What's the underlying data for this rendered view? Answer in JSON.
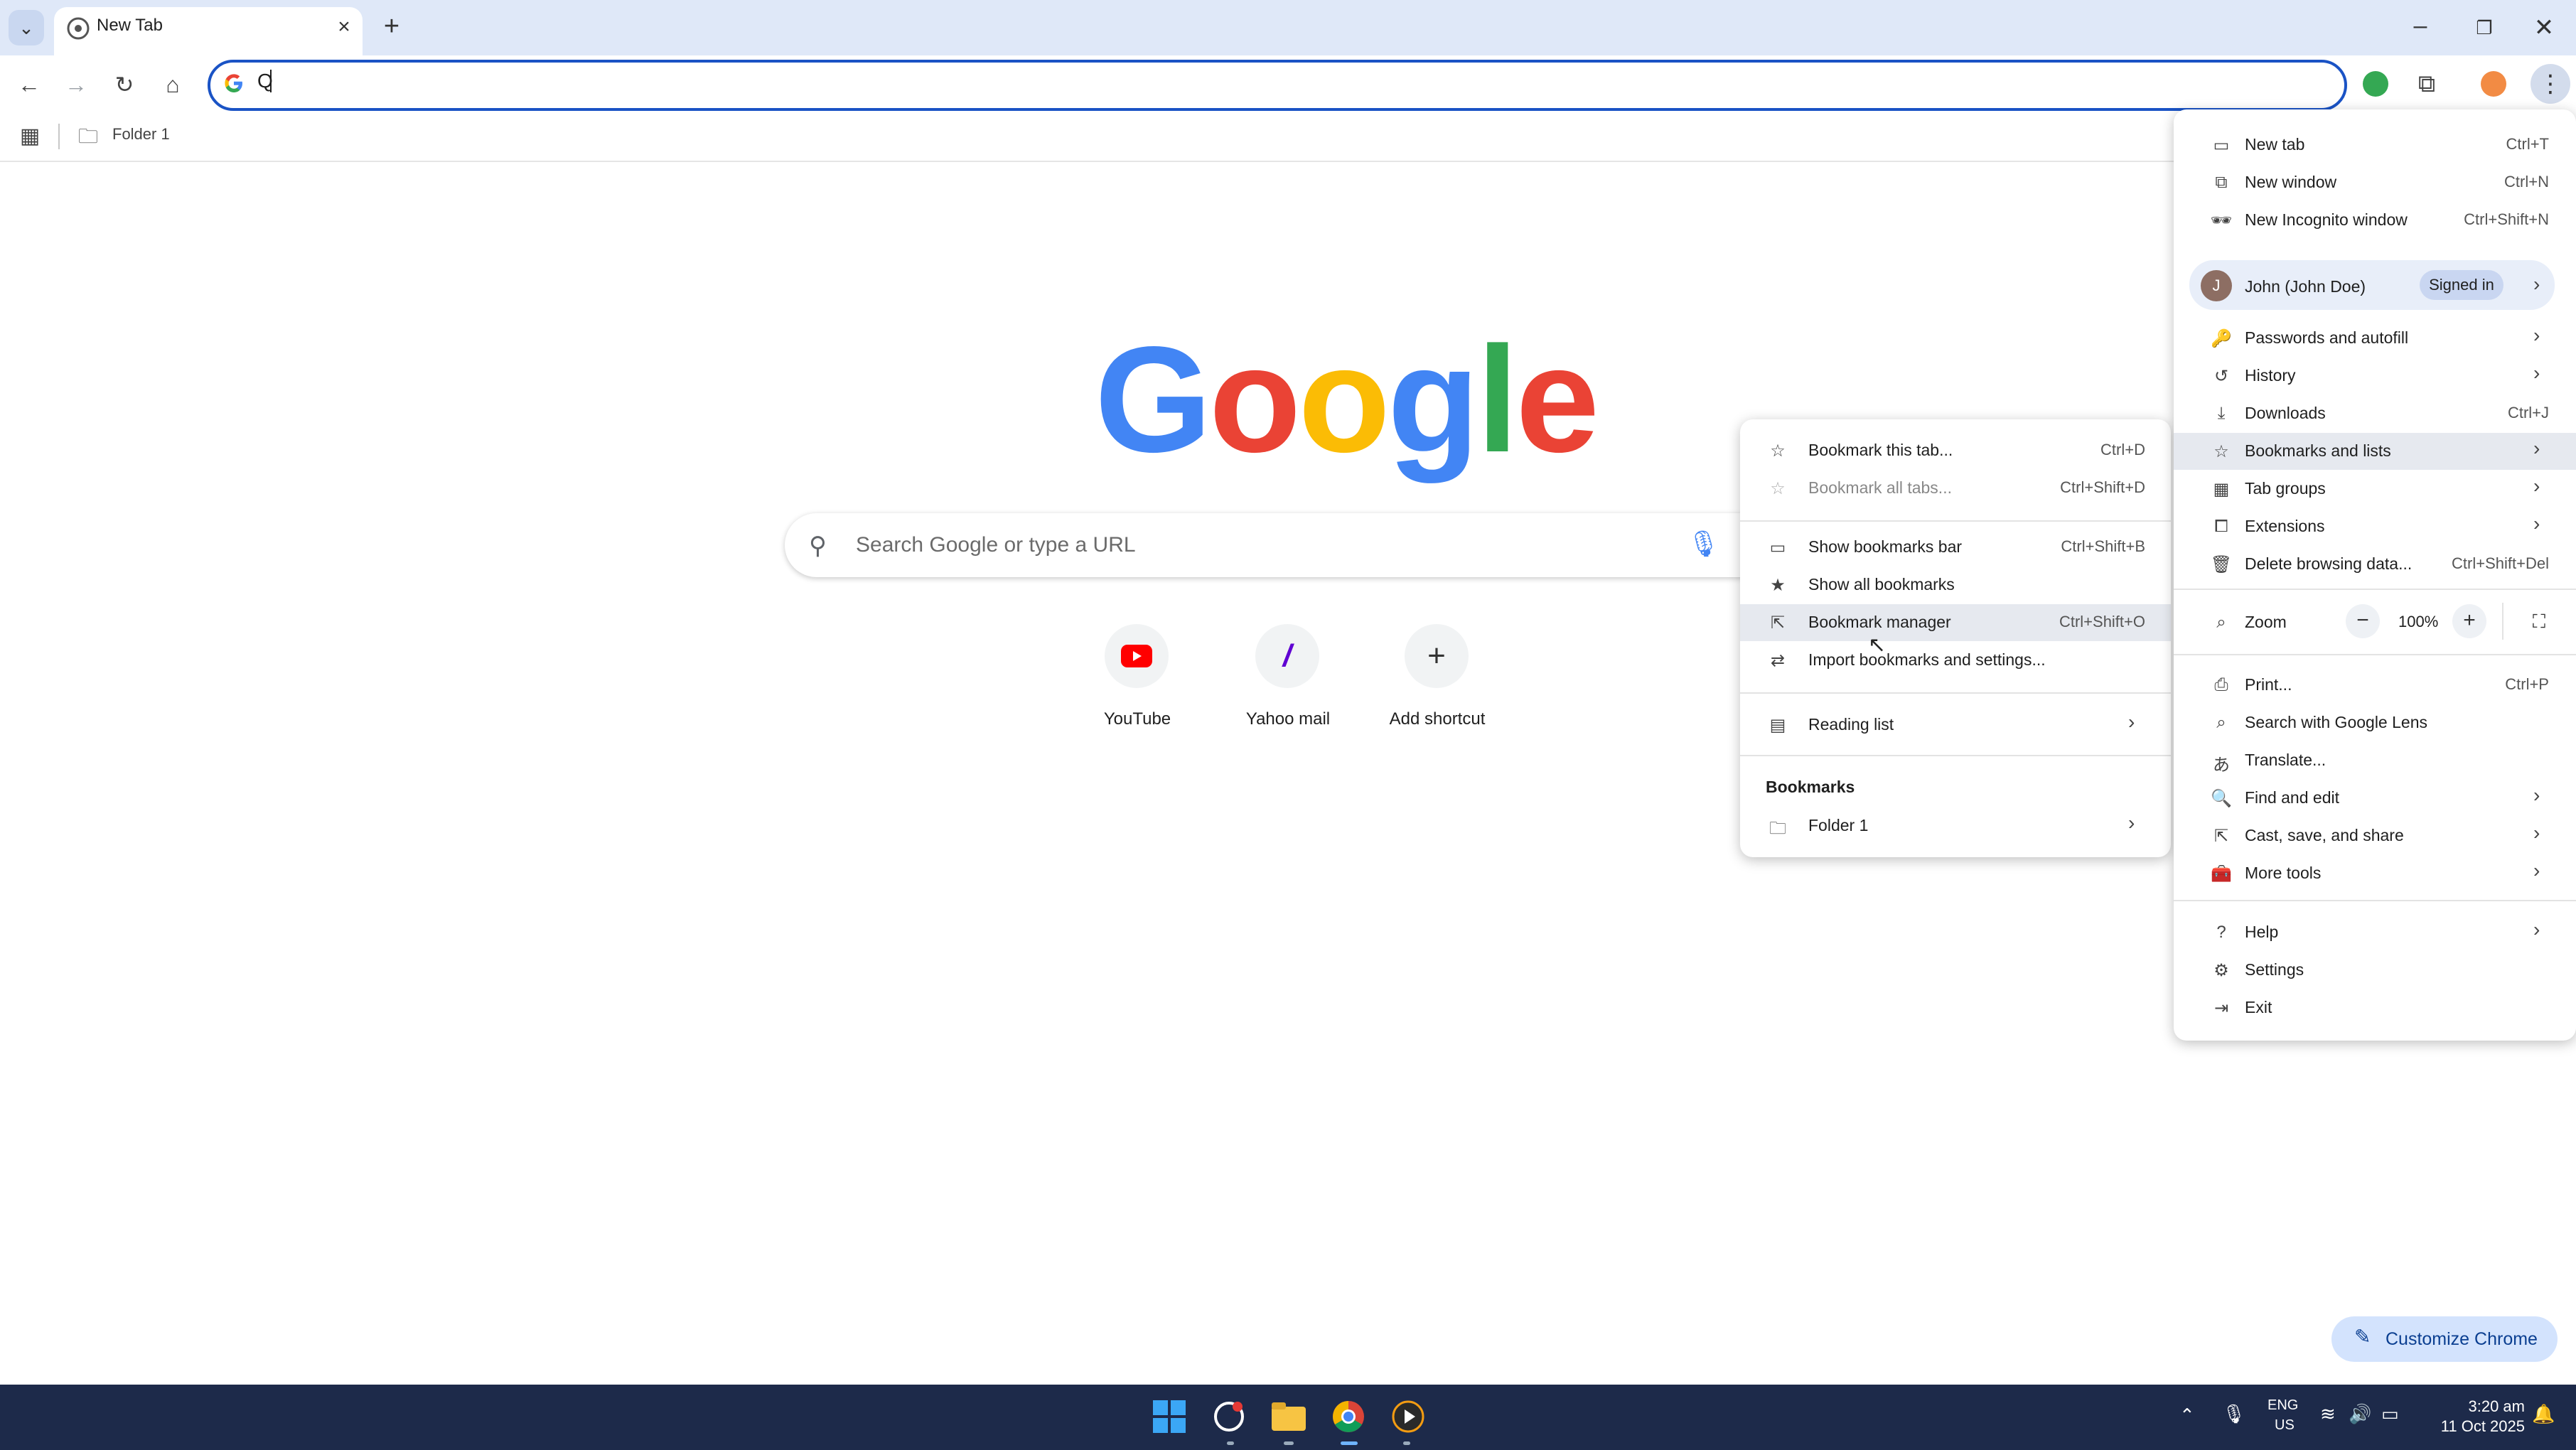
{
  "browser": {
    "tab_title": "New Tab",
    "omnibox_value": "Q",
    "bookmarks_bar": {
      "folder": "Folder 1"
    }
  },
  "window_controls": {
    "minimize": "–",
    "restore": "❐",
    "close": "✕"
  },
  "newtab": {
    "logo_letters": [
      {
        "ch": "G",
        "color": "#4285F4"
      },
      {
        "ch": "o",
        "color": "#EA4335"
      },
      {
        "ch": "o",
        "color": "#FBBC05"
      },
      {
        "ch": "g",
        "color": "#4285F4"
      },
      {
        "ch": "l",
        "color": "#34A853"
      },
      {
        "ch": "e",
        "color": "#EA4335"
      }
    ],
    "search_placeholder": "Search Google or type a URL",
    "shortcuts": [
      {
        "label": "YouTube",
        "icon": "youtube-icon"
      },
      {
        "label": "Yahoo mail",
        "icon": "yahoo-icon"
      },
      {
        "label": "Add shortcut",
        "icon": "plus-icon"
      }
    ],
    "customize_label": "Customize Chrome"
  },
  "main_menu": {
    "items_top": [
      {
        "label": "New tab",
        "shortcut": "Ctrl+T"
      },
      {
        "label": "New window",
        "shortcut": "Ctrl+N"
      },
      {
        "label": "New Incognito window",
        "shortcut": "Ctrl+Shift+N"
      }
    ],
    "profile": {
      "initial": "J",
      "name": "John (John Doe)",
      "badge": "Signed in"
    },
    "items_mid": [
      {
        "label": "Passwords and autofill",
        "shortcut": "",
        "arrow": true
      },
      {
        "label": "History",
        "shortcut": "",
        "arrow": true
      },
      {
        "label": "Downloads",
        "shortcut": "Ctrl+J",
        "arrow": false
      },
      {
        "label": "Bookmarks and lists",
        "shortcut": "",
        "arrow": true
      },
      {
        "label": "Tab groups",
        "shortcut": "",
        "arrow": true
      },
      {
        "label": "Extensions",
        "shortcut": "",
        "arrow": true
      },
      {
        "label": "Delete browsing data...",
        "shortcut": "Ctrl+Shift+Del",
        "arrow": false
      }
    ],
    "zoom": {
      "label": "Zoom",
      "value": "100%",
      "minus": "−",
      "plus": "+"
    },
    "items_tools": [
      {
        "label": "Print...",
        "shortcut": "Ctrl+P",
        "arrow": false
      },
      {
        "label": "Search with Google Lens",
        "shortcut": "",
        "arrow": false
      },
      {
        "label": "Translate...",
        "shortcut": "",
        "arrow": false
      },
      {
        "label": "Find and edit",
        "shortcut": "",
        "arrow": true
      },
      {
        "label": "Cast, save, and share",
        "shortcut": "",
        "arrow": true
      },
      {
        "label": "More tools",
        "shortcut": "",
        "arrow": true
      }
    ],
    "items_bottom": [
      {
        "label": "Help",
        "shortcut": "",
        "arrow": true
      },
      {
        "label": "Settings",
        "shortcut": "",
        "arrow": false
      },
      {
        "label": "Exit",
        "shortcut": "",
        "arrow": false
      }
    ]
  },
  "bookmarks_submenu": {
    "items_a": [
      {
        "label": "Bookmark this tab...",
        "shortcut": "Ctrl+D"
      },
      {
        "label": "Bookmark all tabs...",
        "shortcut": "Ctrl+Shift+D"
      }
    ],
    "items_b": [
      {
        "label": "Show bookmarks bar",
        "shortcut": "Ctrl+Shift+B"
      },
      {
        "label": "Show all bookmarks",
        "shortcut": ""
      },
      {
        "label": "Bookmark manager",
        "shortcut": "Ctrl+Shift+O"
      },
      {
        "label": "Import bookmarks and settings...",
        "shortcut": ""
      }
    ],
    "reading_list": "Reading list",
    "section_title": "Bookmarks",
    "folder": "Folder 1"
  },
  "taskbar": {
    "lang_top": "ENG",
    "lang_bottom": "US",
    "time": "3:20 am",
    "date": "11 Oct 2025"
  }
}
